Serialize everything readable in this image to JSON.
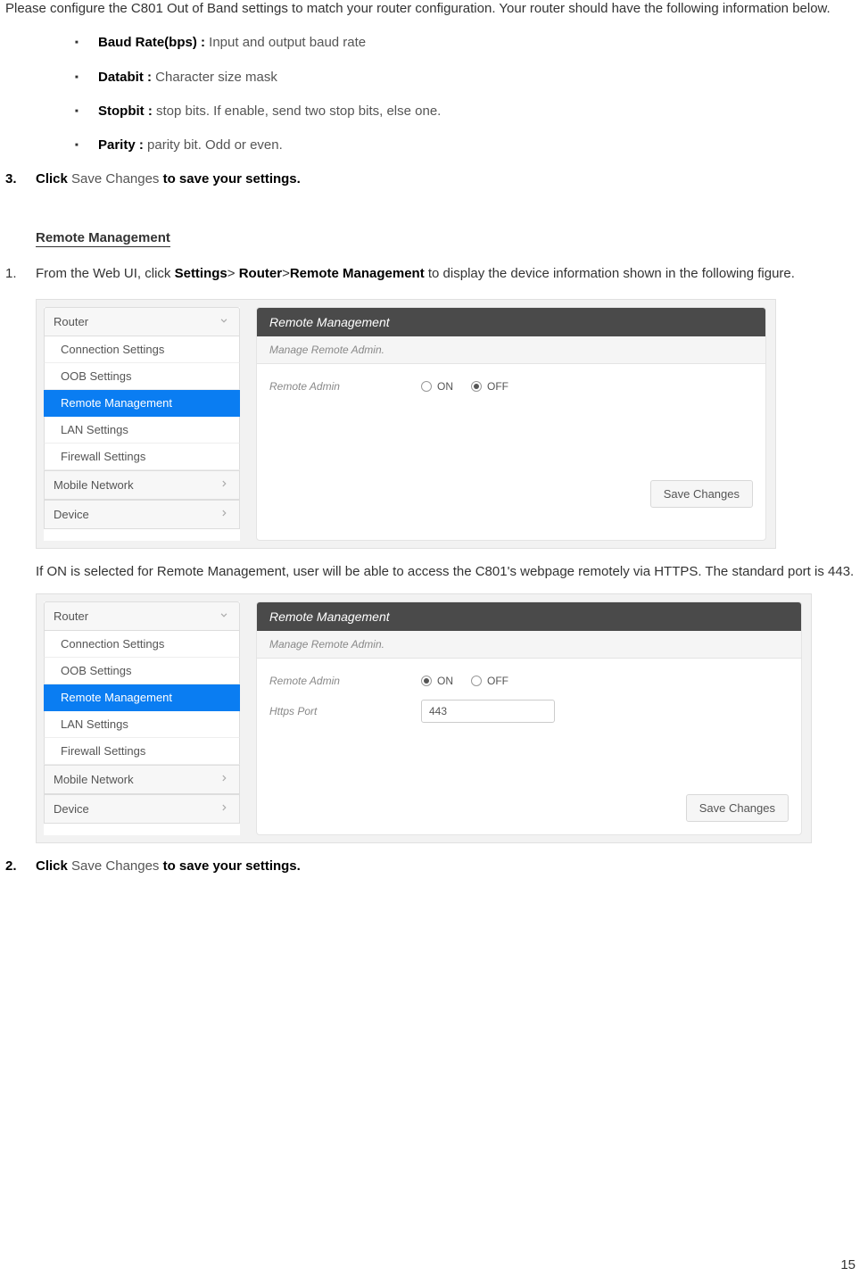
{
  "intro": "Please configure the C801 Out of Band settings to match your router configuration. Your router should have the following information below.",
  "bullets": [
    {
      "label": "Baud Rate(bps) : ",
      "desc": "Input and output baud rate"
    },
    {
      "label": "Databit : ",
      "desc": "Character size mask"
    },
    {
      "label": "Stopbit : ",
      "desc": "stop bits. If enable, send two stop bits, else one."
    },
    {
      "label": "Parity : ",
      "desc": "parity bit. Odd or even."
    }
  ],
  "step3": {
    "num": "3.",
    "pre": "Click ",
    "gray": "Save Changes",
    "post": " to save your settings."
  },
  "section_heading": "Remote Management",
  "step1": {
    "num": "1.",
    "pre": "From the Web UI, click ",
    "b1": "Settings",
    "sep1": "> ",
    "b2": "Router",
    "sep2": ">",
    "b3": "Remote Management",
    "post": " to display the device information shown in the following figure."
  },
  "sidebar": {
    "router": "Router",
    "items": [
      "Connection Settings",
      "OOB Settings",
      "Remote Management",
      "LAN Settings",
      "Firewall Settings"
    ],
    "mobile": "Mobile Network",
    "device": "Device"
  },
  "panel": {
    "title": "Remote Management",
    "subtitle": "Manage Remote Admin.",
    "remote_admin_label": "Remote Admin",
    "on": "ON",
    "off": "OFF",
    "https_port_label": "Https Port",
    "https_port_value": "443",
    "save": "Save Changes"
  },
  "after_fig1": "If ON is selected for Remote Management, user will be able to access the C801's webpage remotely via HTTPS. The standard port is 443.",
  "step2": {
    "num": "2.",
    "pre": "Click ",
    "gray": "Save Changes",
    "post": " to save your settings."
  },
  "page_number": "15"
}
